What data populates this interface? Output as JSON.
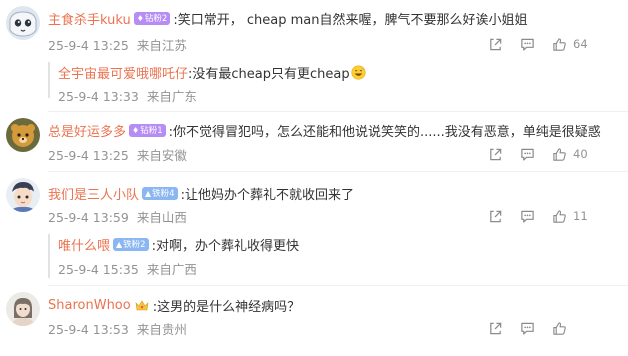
{
  "comments": [
    {
      "username": "主食杀手kuku",
      "badge": "钻粉2",
      "text": ":笑口常开，  cheap man自然来喔，脾气不要那么好诶小姐姐",
      "date": "25-9-4 13:25",
      "location": "来自江苏",
      "likes": "64",
      "reply": {
        "username": "全宇宙最可爱哦哪吒仔",
        "text": ":没有最cheap只有更cheap",
        "emoji": "grinning-sweat-emoji",
        "date": "25-9-4 13:33",
        "location": "来自广东"
      }
    },
    {
      "username": "总是好运多多",
      "badge": "钻粉1",
      "text": ":你不觉得冒犯吗，怎么还能和他说说笑笑的......我没有恶意，单纯是很疑惑",
      "date": "25-9-4 13:25",
      "location": "来自安徽",
      "likes": "40"
    },
    {
      "username": "我们是三人小队",
      "badge": "铁粉4",
      "text": ":让他妈办个葬礼不就收回来了",
      "date": "25-9-4 13:59",
      "location": "来自山西",
      "likes": "11",
      "reply": {
        "username": "唯什么喂",
        "badge": "铁粉2",
        "text": ":对啊，办个葬礼收得更快",
        "date": "25-9-4 15:35",
        "location": "来自广西"
      }
    },
    {
      "username": "SharonWhoo",
      "text": ":这男的是什么神经病吗？",
      "date": "25-9-4 13:53",
      "location": "来自贵州",
      "likes": ""
    }
  ],
  "icons": {
    "share": "share-icon",
    "comment": "comment-icon",
    "like": "thumbs-up-icon",
    "diamond_badge": "diamond-icon",
    "iron_badge": "iron-fan-icon",
    "crown_badge": "crown-icon"
  },
  "colors": {
    "username": "#eb7350",
    "meta_text": "#939393",
    "badge_purple": "#b68cf5",
    "badge_blue": "#8ab6f2"
  }
}
